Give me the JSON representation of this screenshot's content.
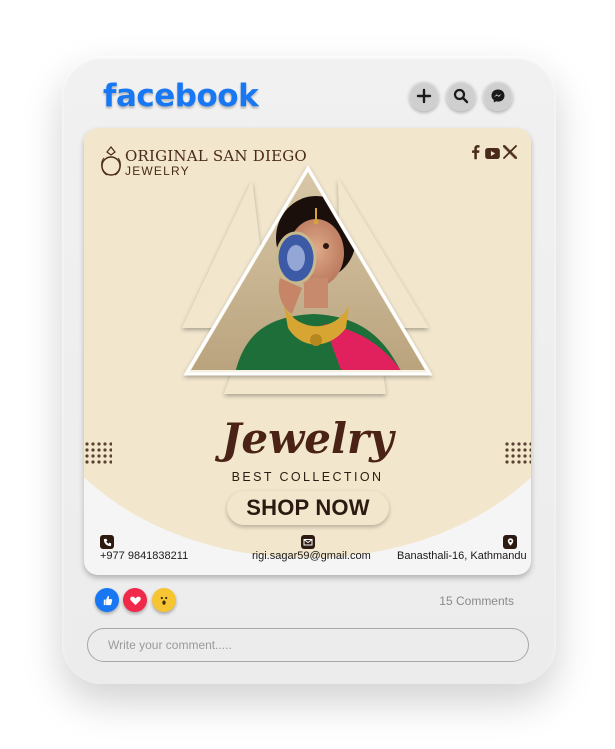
{
  "header": {
    "app_name": "facebook",
    "buttons": [
      {
        "name": "add",
        "icon": "plus-icon"
      },
      {
        "name": "search",
        "icon": "search-icon"
      },
      {
        "name": "messenger",
        "icon": "messenger-icon"
      }
    ]
  },
  "post": {
    "brand": {
      "name": "ORIGINAL SAN DIEGO",
      "subtitle": "JEWELRY",
      "logo_icon": "ring-icon"
    },
    "social_icons": [
      "facebook-icon",
      "youtube-icon",
      "x-icon"
    ],
    "title": "Jewelry",
    "subtitle": "BEST COLLECTION",
    "cta_label": "SHOP NOW",
    "contacts": {
      "phone": "+977 9841838211",
      "email": "rigi.sagar59@gmail.com",
      "address": "Banasthali-16, Kathmandu"
    },
    "photo": "woman-jewelry-photo"
  },
  "footer": {
    "reactions": [
      "like-icon",
      "love-icon",
      "wow-icon"
    ],
    "comments_count": "15 Comments",
    "comment_placeholder": "Write your comment....."
  },
  "colors": {
    "facebook_blue": "#1877f2",
    "beige": "#f2e6cd",
    "brown": "#4b2316",
    "card_bg": "#f5f5f5"
  }
}
